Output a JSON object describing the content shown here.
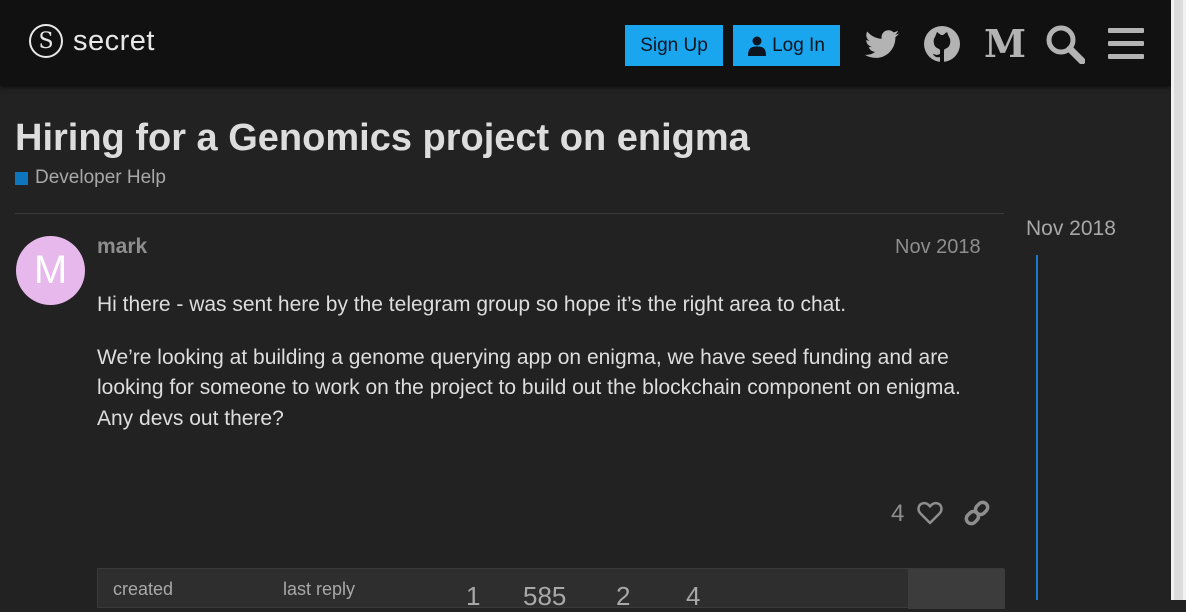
{
  "header": {
    "logo_text": "secret",
    "logo_mark": "S",
    "signup_label": "Sign Up",
    "login_label": "Log In",
    "icons": [
      "twitter-icon",
      "github-icon",
      "medium-icon",
      "search-icon",
      "menu-icon"
    ],
    "medium_glyph": "M"
  },
  "topic": {
    "title": "Hiring for a Genomics project on enigma",
    "category": "Developer Help",
    "category_color": "#0e76bd"
  },
  "post": {
    "avatar_letter": "M",
    "avatar_color": "#e6b8ec",
    "username": "mark",
    "date": "Nov 2018",
    "paragraphs": [
      "Hi there - was sent here by the telegram group so hope it’s the right area to chat.",
      "We’re looking at building a genome querying app on enigma, we have seed funding and are looking for someone to work on the project to build out the blockchain component on enigma. Any devs out there?"
    ],
    "likes": "4"
  },
  "summary": {
    "created_label": "created",
    "last_reply_label": "last reply",
    "replies": "1",
    "views": "585",
    "users": "2",
    "likes": "4"
  },
  "timeline": {
    "date": "Nov 2018"
  },
  "colors": {
    "accent": "#1aa5ef",
    "background": "#222222",
    "header": "#111111",
    "timeline": "#1a7ad0"
  }
}
